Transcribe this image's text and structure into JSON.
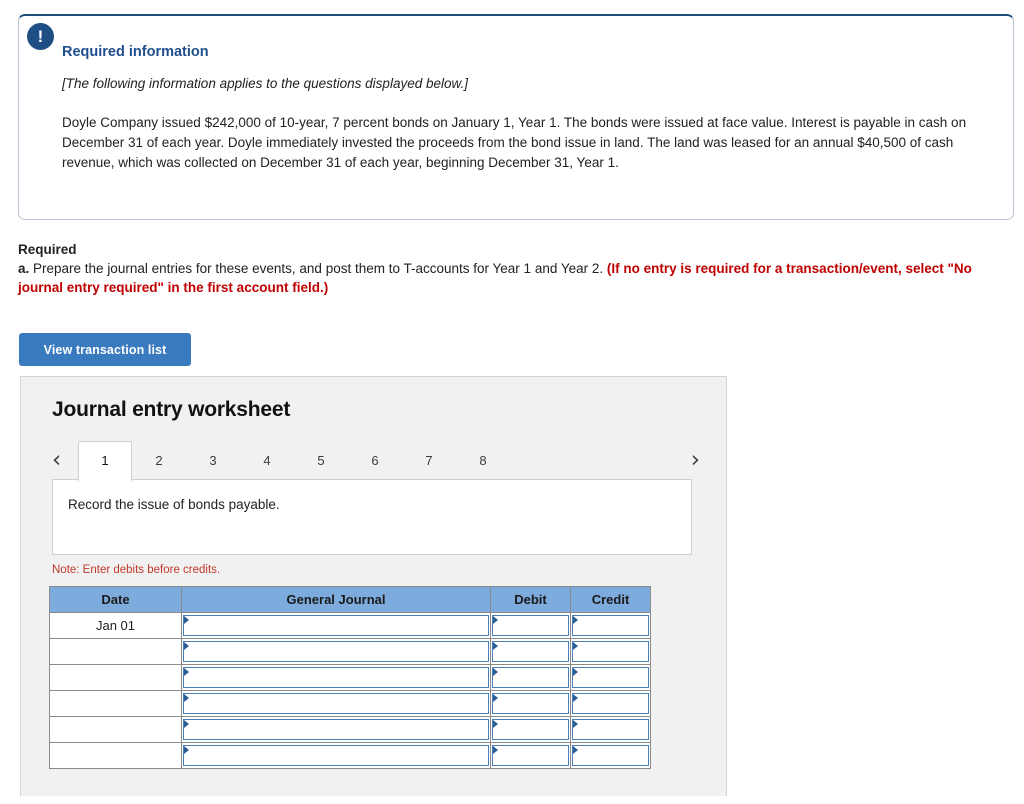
{
  "alert": {
    "icon": "exclamation-icon",
    "glyph": "!"
  },
  "required_information": {
    "heading": "Required information",
    "applies_note": "[The following information applies to the questions displayed below.]",
    "body": "Doyle Company issued $242,000 of 10-year, 7 percent bonds on January 1, Year 1. The bonds were issued at face value. Interest is payable in cash on December 31 of each year. Doyle immediately invested the proceeds from the bond issue in land. The land was leased for an annual $40,500 of cash revenue, which was collected on December 31 of each year, beginning December 31, Year 1."
  },
  "required": {
    "label": "Required",
    "item_letter": "a.",
    "item_text": " Prepare the journal entries for these events, and post them to T-accounts for Year 1 and Year 2. ",
    "item_red": "(If no entry is required for a transaction/event, select \"No journal entry required\" in the first account field.)"
  },
  "buttons": {
    "view_transaction_list": "View transaction list"
  },
  "worksheet": {
    "title": "Journal entry worksheet",
    "prev_arrow": "‹",
    "next_arrow": "›",
    "tabs": [
      {
        "label": "1",
        "active": true
      },
      {
        "label": "2",
        "active": false
      },
      {
        "label": "3",
        "active": false
      },
      {
        "label": "4",
        "active": false
      },
      {
        "label": "5",
        "active": false
      },
      {
        "label": "6",
        "active": false
      },
      {
        "label": "7",
        "active": false
      },
      {
        "label": "8",
        "active": false
      }
    ],
    "active_tab_description": "Record the issue of bonds payable.",
    "note": "Note: Enter debits before credits."
  },
  "journal_table": {
    "headers": [
      "Date",
      "General Journal",
      "Debit",
      "Credit"
    ],
    "rows": [
      {
        "date": "Jan 01",
        "general_journal": "",
        "debit": "",
        "credit": ""
      },
      {
        "date": "",
        "general_journal": "",
        "debit": "",
        "credit": ""
      },
      {
        "date": "",
        "general_journal": "",
        "debit": "",
        "credit": ""
      },
      {
        "date": "",
        "general_journal": "",
        "debit": "",
        "credit": ""
      },
      {
        "date": "",
        "general_journal": "",
        "debit": "",
        "credit": ""
      },
      {
        "date": "",
        "general_journal": "",
        "debit": "",
        "credit": ""
      }
    ]
  },
  "colors": {
    "accent_blue": "#3a7bc0",
    "heading_blue": "#1f4e8c",
    "alert_blue": "#1f4e84",
    "table_header_blue": "#7dabdd",
    "warning_red": "#c00000",
    "note_red": "#c0392b",
    "panel_gray": "#f1f1f1"
  }
}
